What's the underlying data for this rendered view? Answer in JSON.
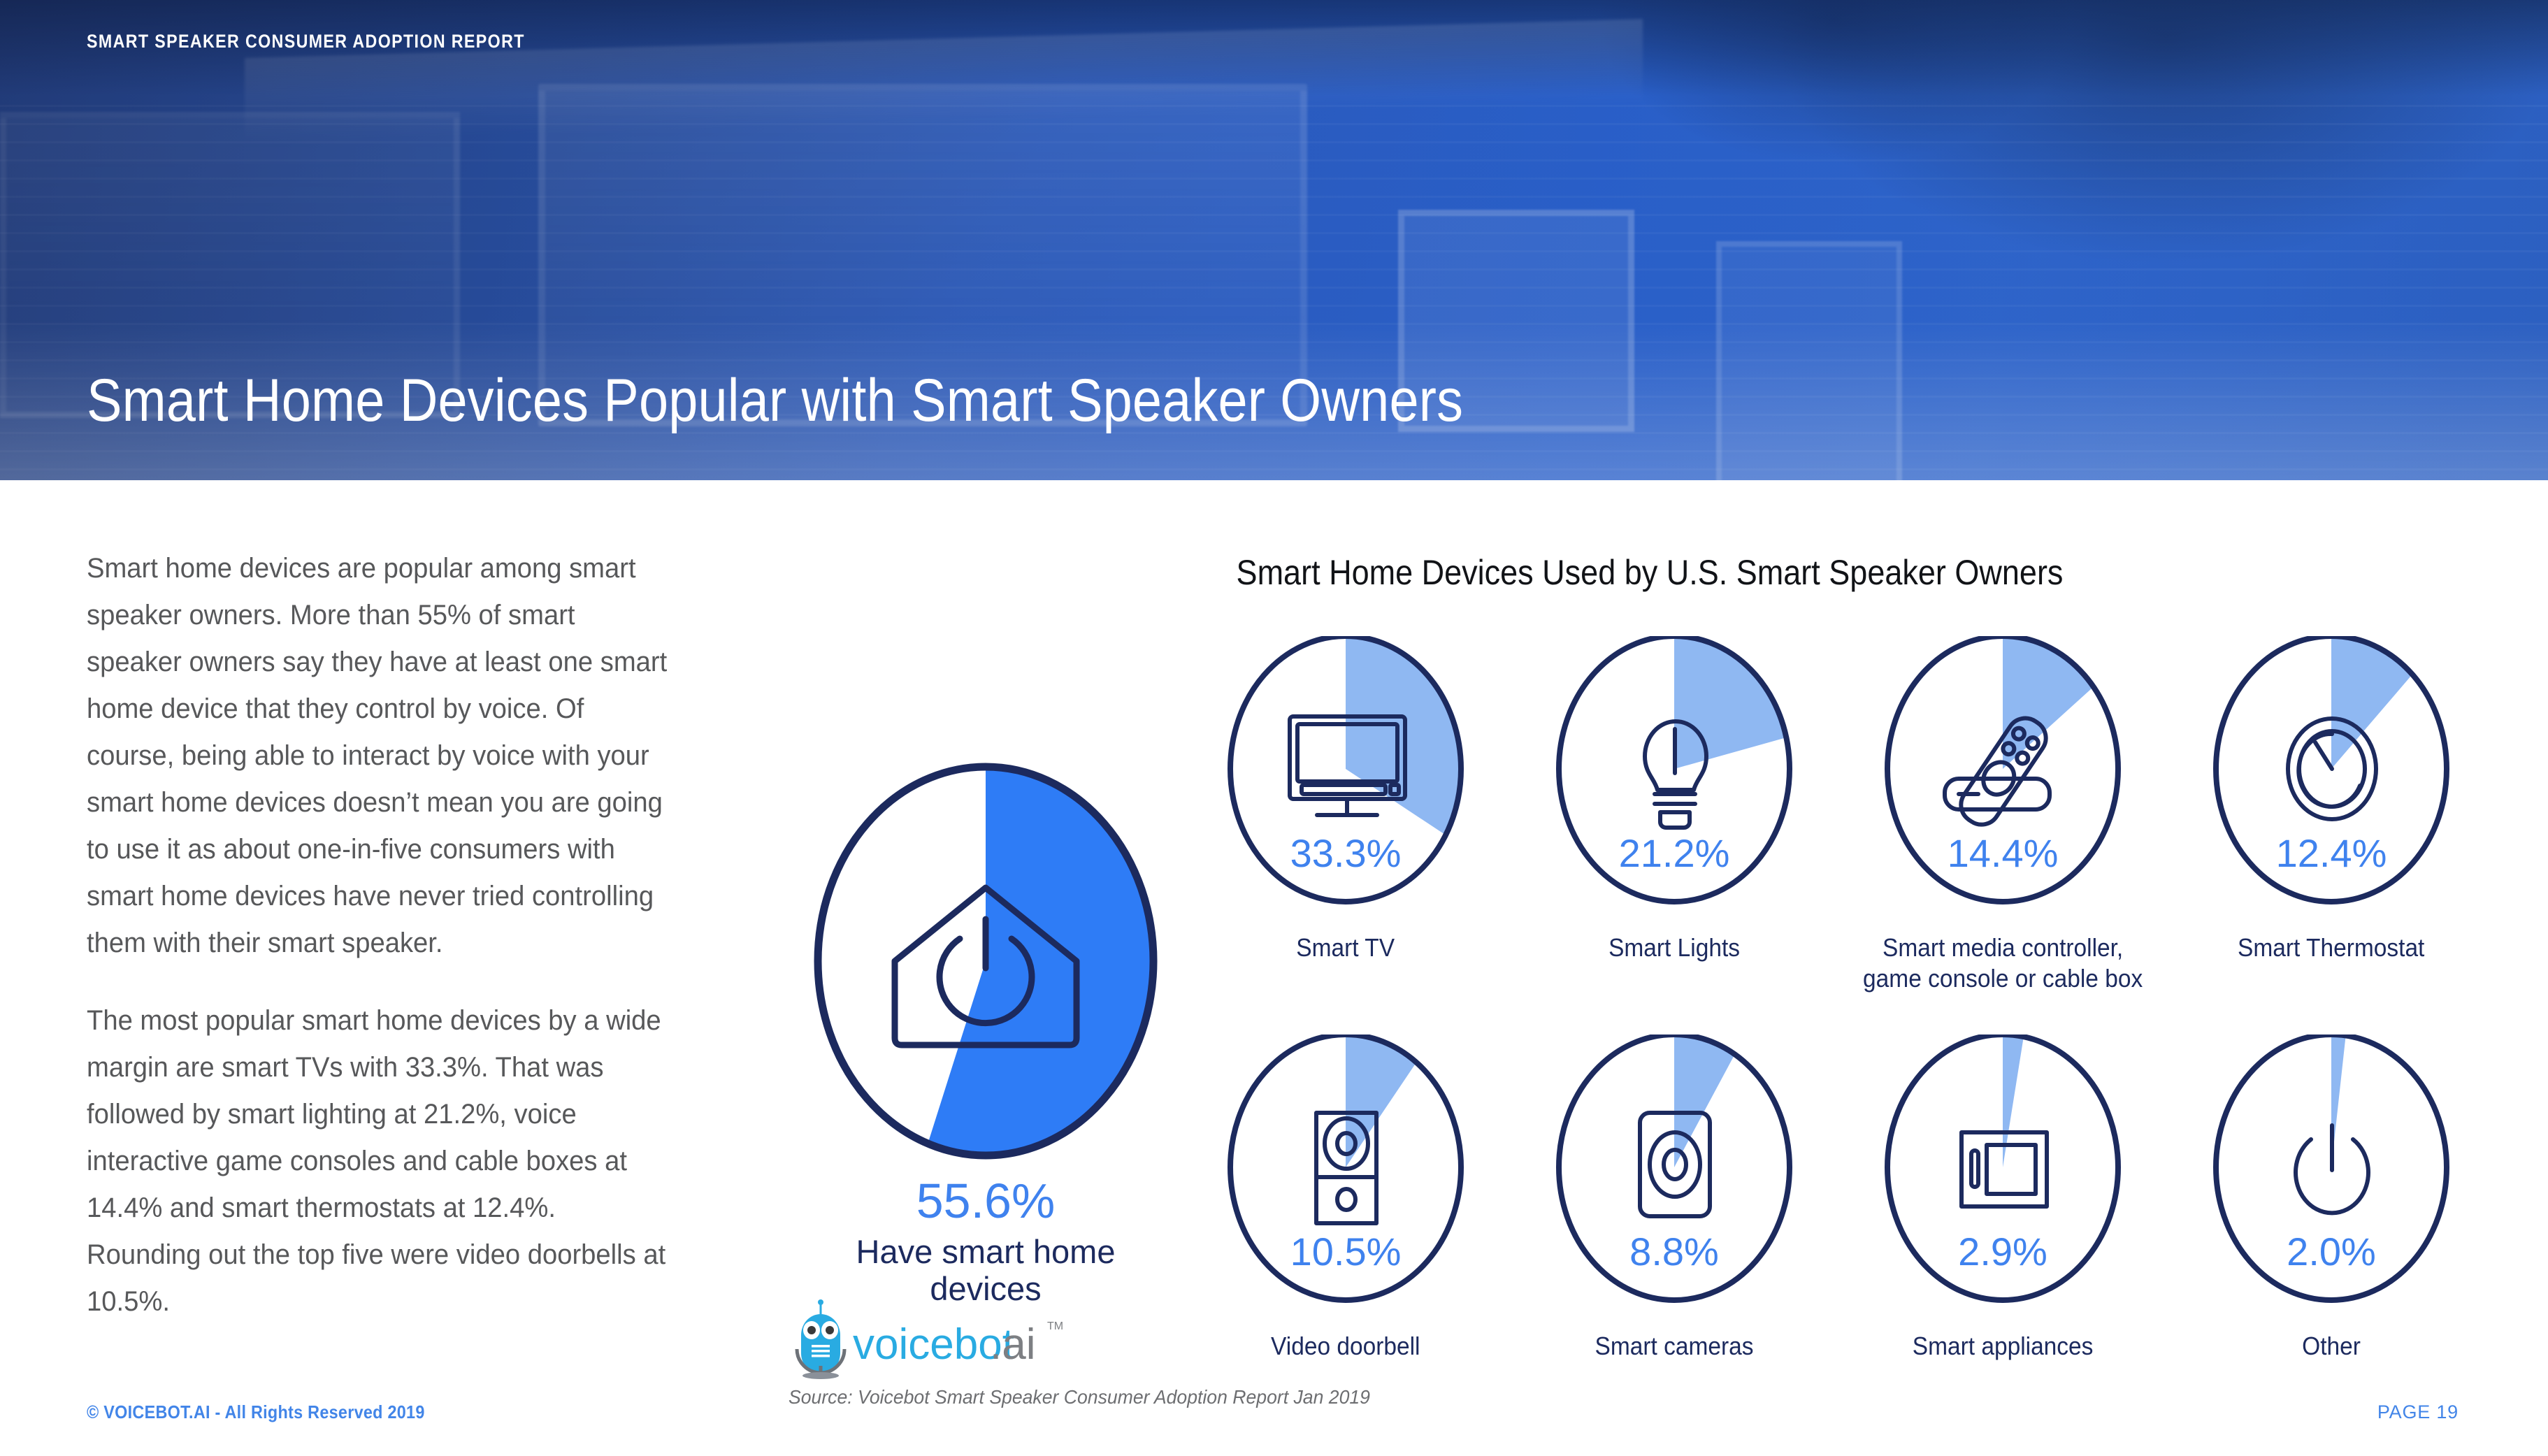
{
  "header": {
    "kicker": "SMART SPEAKER CONSUMER ADOPTION REPORT",
    "title": "Smart Home Devices Popular with Smart Speaker Owners"
  },
  "body": {
    "paragraph_1": "Smart home devices are popular among smart speaker owners. More than 55% of smart speaker owners say they have at least one smart home device that they control by voice. Of course, being able to interact by voice with your smart home devices doesn’t mean you are going to use it as about one-in-five consumers with smart home devices have never tried controlling them with their smart speaker.",
    "paragraph_2": "The most popular smart home devices by a wide margin are smart TVs with 33.3%. That was followed by smart lighting at 21.2%, voice interactive game consoles and cable boxes at 14.4% and smart thermostats at 12.4%. Rounding out the top five were video doorbells at 10.5%."
  },
  "logo": {
    "name_primary": "voicebot",
    "name_secondary": ".ai",
    "trademark": "TM"
  },
  "source_note": "Source: Voicebot Smart Speaker Consumer Adoption Report Jan 2019",
  "footer": {
    "copyright": "© VOICEBOT.AI - All Rights Reserved 2019",
    "page": "PAGE 19"
  },
  "colors": {
    "accent_blue": "#3F82EE",
    "light_blue_wedge": "#8FB8F2",
    "navy": "#1C2A5E",
    "strong_blue_wedge": "#2E7CF6",
    "body_text": "#57585A"
  },
  "chart_data": {
    "type": "pie",
    "title": "Smart Home Devices Used by U.S. Smart Speaker Owners",
    "subtitle": "",
    "xlabel": "",
    "ylabel": "",
    "units": "percent of U.S. smart speaker owners",
    "legend": "none",
    "grid": false,
    "highlight": {
      "label": "Have smart home devices",
      "value": 55.6,
      "value_label": "55.6%",
      "icon": "smart-home-power-icon",
      "wedge_color": "#2E7CF6"
    },
    "categories": [
      "Smart TV",
      "Smart Lights",
      "Smart media controller, game console or cable box",
      "Smart Thermostat",
      "Video doorbell",
      "Smart cameras",
      "Smart appliances",
      "Other"
    ],
    "values": [
      33.3,
      21.2,
      14.4,
      12.4,
      10.5,
      8.8,
      2.9,
      2.0
    ],
    "value_labels": [
      "33.3%",
      "21.2%",
      "14.4%",
      "12.4%",
      "10.5%",
      "8.8%",
      "2.9%",
      "2.0%"
    ],
    "items": [
      {
        "label": "Smart TV",
        "label_line1": "Smart TV",
        "label_line2": "",
        "value": 33.3,
        "value_label": "33.3%",
        "icon": "television-icon"
      },
      {
        "label": "Smart Lights",
        "label_line1": "Smart Lights",
        "label_line2": "",
        "value": 21.2,
        "value_label": "21.2%",
        "icon": "lightbulb-icon"
      },
      {
        "label": "Smart media controller, game console or cable box",
        "label_line1": "Smart media controller,",
        "label_line2": "game console or cable box",
        "value": 14.4,
        "value_label": "14.4%",
        "icon": "remote-control-icon"
      },
      {
        "label": "Smart Thermostat",
        "label_line1": "Smart Thermostat",
        "label_line2": "",
        "value": 12.4,
        "value_label": "12.4%",
        "icon": "thermostat-dial-icon"
      },
      {
        "label": "Video doorbell",
        "label_line1": "Video doorbell",
        "label_line2": "",
        "value": 10.5,
        "value_label": "10.5%",
        "icon": "video-doorbell-icon"
      },
      {
        "label": "Smart cameras",
        "label_line1": "Smart cameras",
        "label_line2": "",
        "value": 8.8,
        "value_label": "8.8%",
        "icon": "security-camera-icon"
      },
      {
        "label": "Smart appliances",
        "label_line1": "Smart appliances",
        "label_line2": "",
        "value": 2.9,
        "value_label": "2.9%",
        "icon": "appliance-icon"
      },
      {
        "label": "Other",
        "label_line1": "Other",
        "label_line2": "",
        "value": 2.0,
        "value_label": "2.0%",
        "icon": "power-button-icon"
      }
    ]
  }
}
